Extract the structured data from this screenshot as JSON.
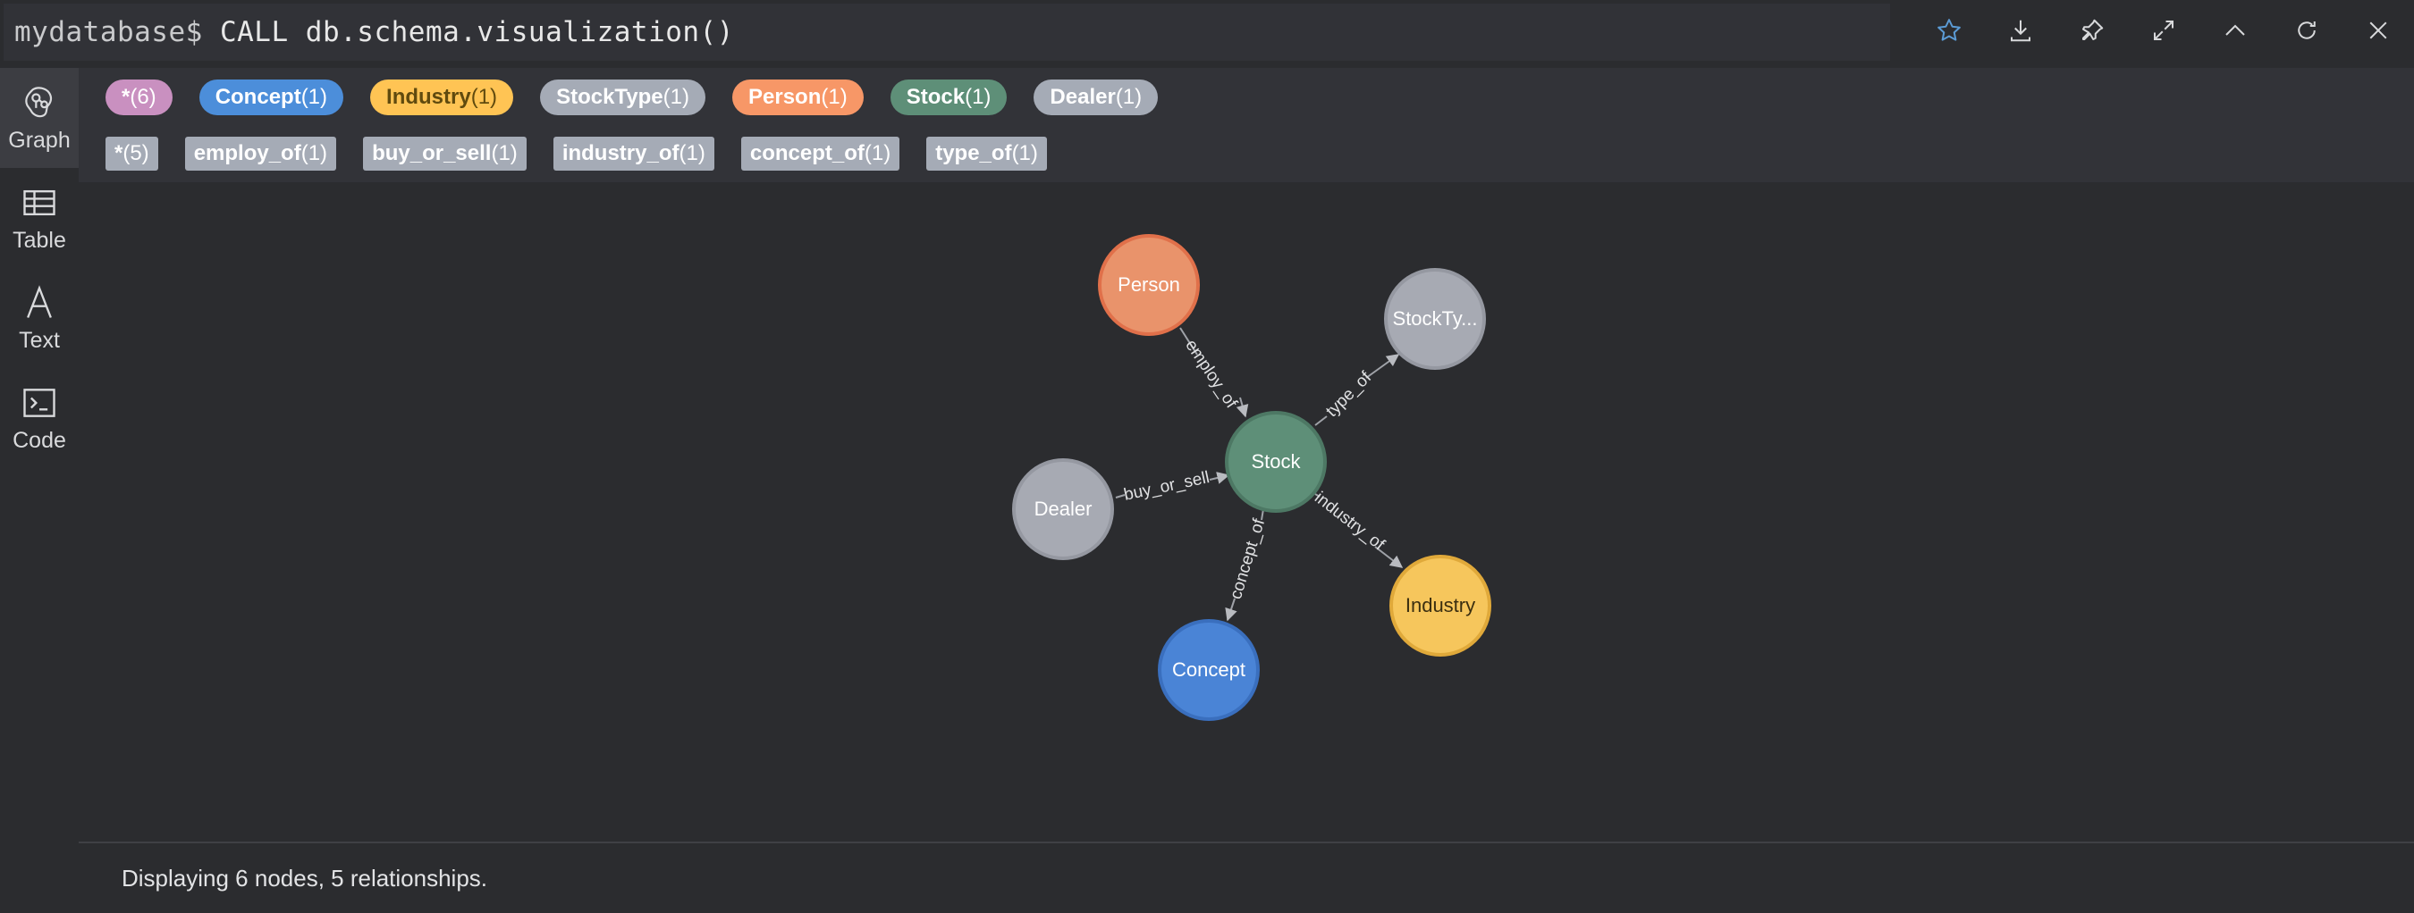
{
  "command": {
    "prompt": "mydatabase$",
    "query": " CALL db.schema.visualization()"
  },
  "toolbar": {
    "icons": [
      "star-icon",
      "download-icon",
      "pin-icon",
      "expand-icon",
      "collapse-up-icon",
      "refresh-icon",
      "close-icon"
    ],
    "accent": "#5b9bd5"
  },
  "sidebar": {
    "items": [
      {
        "label": "Graph",
        "icon": "graph-icon"
      },
      {
        "label": "Table",
        "icon": "table-icon"
      },
      {
        "label": "Text",
        "icon": "text-icon"
      },
      {
        "label": "Code",
        "icon": "code-icon"
      }
    ]
  },
  "legend": {
    "node_labels": [
      {
        "name": "*",
        "count": "(6)",
        "color": "#c990c0",
        "text": "#ffffff"
      },
      {
        "name": "Concept",
        "count": "(1)",
        "color": "#4c8eda",
        "text": "#ffffff"
      },
      {
        "name": "Industry",
        "count": "(1)",
        "color": "#ffc454",
        "text": "#604a0e"
      },
      {
        "name": "StockType",
        "count": "(1)",
        "color": "#a5abb6",
        "text": "#ffffff"
      },
      {
        "name": "Person",
        "count": "(1)",
        "color": "#f79767",
        "text": "#ffffff"
      },
      {
        "name": "Stock",
        "count": "(1)",
        "color": "#57c7a3",
        "text": "#ffffff"
      },
      {
        "name": "Dealer",
        "count": "(1)",
        "color": "#a5abb6",
        "text": "#ffffff"
      }
    ],
    "relationship_types": [
      {
        "name": "*",
        "count": "(5)"
      },
      {
        "name": "employ_of",
        "count": "(1)"
      },
      {
        "name": "buy_or_sell",
        "count": "(1)"
      },
      {
        "name": "industry_of",
        "count": "(1)"
      },
      {
        "name": "concept_of",
        "count": "(1)"
      },
      {
        "name": "type_of",
        "count": "(1)"
      }
    ]
  },
  "graph": {
    "nodes": [
      {
        "id": "person",
        "label": "Person",
        "fill": "#e9936b",
        "stroke": "#e0704a",
        "text": "#ffffff"
      },
      {
        "id": "stocktype",
        "label": "StockTy...",
        "fill": "#a7aab3",
        "stroke": "#9598a1",
        "text": "#ffffff"
      },
      {
        "id": "stock",
        "label": "Stock",
        "fill": "#5e8f78",
        "stroke": "#4d7864",
        "text": "#ffffff"
      },
      {
        "id": "dealer",
        "label": "Dealer",
        "fill": "#a7aab3",
        "stroke": "#9598a1",
        "text": "#ffffff"
      },
      {
        "id": "industry",
        "label": "Industry",
        "fill": "#f6c65c",
        "stroke": "#e0a93a",
        "text": "#3a2e10"
      },
      {
        "id": "concept",
        "label": "Concept",
        "fill": "#4a84d6",
        "stroke": "#3a6fbe",
        "text": "#ffffff"
      }
    ],
    "edges": [
      {
        "label": "employ_of"
      },
      {
        "label": "type_of"
      },
      {
        "label": "buy_or_sell"
      },
      {
        "label": "industry_of"
      },
      {
        "label": "concept_of"
      }
    ]
  },
  "status": {
    "text": "Displaying 6 nodes, 5 relationships."
  }
}
